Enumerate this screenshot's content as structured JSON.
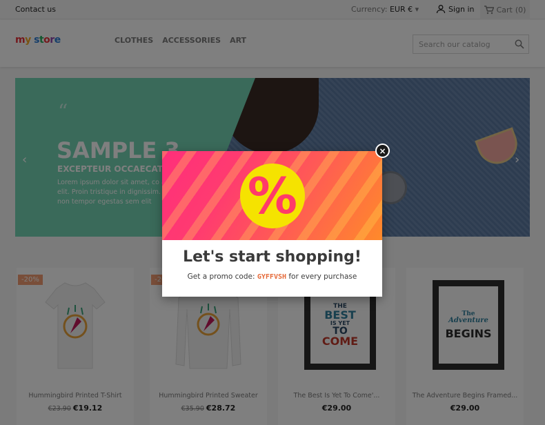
{
  "topbar": {
    "contact": "Contact us",
    "currency_label": "Currency:",
    "currency_value": "EUR €",
    "signin": "Sign in",
    "cart": "Cart",
    "cart_count": "(0)"
  },
  "header": {
    "logo": "my store",
    "nav": [
      "CLOTHES",
      "ACCESSORIES",
      "ART"
    ],
    "search_placeholder": "Search our catalog"
  },
  "hero": {
    "quote_mark": "“",
    "title": "SAMPLE 3",
    "subtitle": "EXCEPTEUR OCCAECAT",
    "text": "Lorem ipsum dolor sit amet, co adipiscing elit. Proin tristique in dignissim. Quisque non tempor egestas sem elit"
  },
  "products": [
    {
      "badge": "-20%",
      "name": "Hummingbird Printed T-Shirt",
      "old_price": "€23.90",
      "price": "€19.12"
    },
    {
      "badge": "-20%",
      "name": "Hummingbird Printed Sweater",
      "old_price": "€35.90",
      "price": "€28.72"
    },
    {
      "badge": "",
      "name": "The Best Is Yet To Come'...",
      "old_price": "",
      "price": "€29.00"
    },
    {
      "badge": "",
      "name": "The Adventure Begins Framed...",
      "old_price": "",
      "price": "€29.00"
    }
  ],
  "poster3": {
    "l1": "THE",
    "l2": "BEST",
    "l3": "IS YET",
    "l4": "TO",
    "l5": "COME"
  },
  "poster4": {
    "l1": "The",
    "l2": "Adventure",
    "l3": "BEGINS"
  },
  "modal": {
    "percent_symbol": "%",
    "title": "Let's start shopping!",
    "sub_before": "Get a promo code:",
    "code": "GYFFVSH",
    "sub_after": "for every purchase",
    "close": "×"
  },
  "colors": {
    "accent": "#f39d72",
    "hero_green": "#74d5b4",
    "promo_code": "#e56a3a"
  }
}
